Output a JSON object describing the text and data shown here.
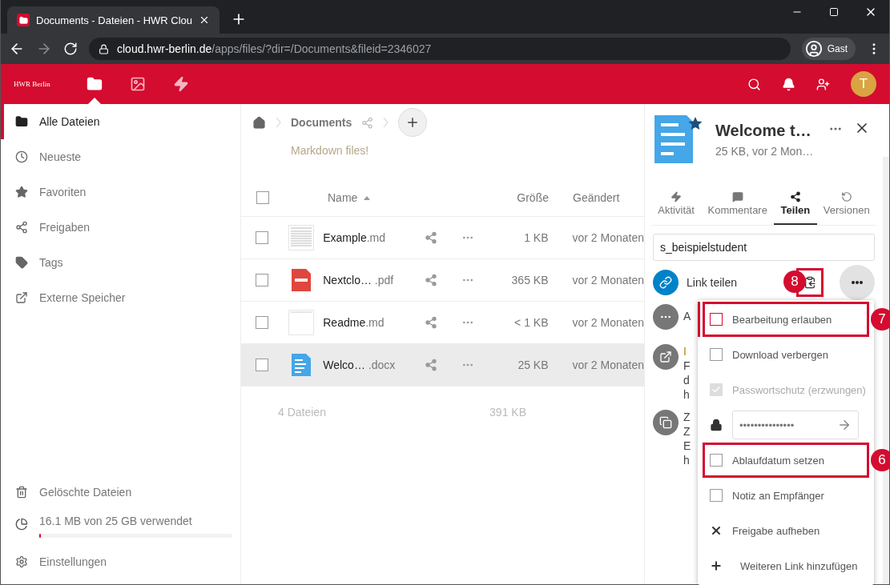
{
  "browser": {
    "tab_title": "Documents - Dateien - HWR Clou",
    "url_host": "cloud.hwr-berlin.de",
    "url_path": "/apps/files/?dir=/Documents&fileid=2346027",
    "profile": "Gast"
  },
  "header": {
    "logo": "HWR Berlin",
    "apps": [
      {
        "kind": "files",
        "selected": true
      },
      {
        "kind": "gallery",
        "selected": false
      },
      {
        "kind": "activity",
        "selected": false
      }
    ],
    "avatar": "T"
  },
  "sidebar": {
    "items": [
      {
        "kind": "folder",
        "label": "Alle Dateien",
        "selected": true
      },
      {
        "kind": "recent",
        "label": "Neueste",
        "selected": false
      },
      {
        "kind": "favorites",
        "label": "Favoriten",
        "selected": false
      },
      {
        "kind": "shares",
        "label": "Freigaben",
        "selected": false
      },
      {
        "kind": "tags",
        "label": "Tags",
        "selected": false
      },
      {
        "kind": "external",
        "label": "Externe Speicher",
        "selected": false
      }
    ],
    "trash": "Gelöschte Dateien",
    "quota": {
      "text": "16.1 MB von 25 GB verwendet",
      "level": 0.01
    },
    "settings": "Einstellungen"
  },
  "files": {
    "all_checked": false,
    "breadcrumb": "Documents",
    "description": "Markdown files!",
    "columns": [
      "Name",
      "Größe",
      "Geändert"
    ],
    "rows": [
      {
        "kind": "md-preview",
        "name": "Example",
        "ext": ".md",
        "size": "1 KB",
        "modified": "vor 2 Monaten",
        "checked": false,
        "selected": false
      },
      {
        "kind": "pdf",
        "name": "Nextclo…",
        "ext": " .pdf",
        "size": "365 KB",
        "modified": "vor 2 Monaten",
        "checked": false,
        "selected": false
      },
      {
        "kind": "md-blank",
        "name": "Readme",
        "ext": ".md",
        "size": "< 1 KB",
        "modified": "vor 2 Monaten",
        "checked": false,
        "selected": false
      },
      {
        "kind": "document",
        "name": "Welco…",
        "ext": " .docx",
        "size": "25 KB",
        "modified": "vor 2 Monaten",
        "checked": false,
        "selected": true
      }
    ],
    "summary": {
      "count": "4 Dateien",
      "size": "391 KB"
    }
  },
  "details": {
    "title": "Welcome t…",
    "subtitle": "25 KB, vor 2 Mon…",
    "tabs": [
      {
        "kind": "activity",
        "label": "Aktivität",
        "selected": false
      },
      {
        "kind": "comments",
        "label": "Kommentare",
        "selected": false
      },
      {
        "kind": "share",
        "label": "Teilen",
        "selected": true
      },
      {
        "kind": "versions",
        "label": "Versionen",
        "selected": false
      }
    ],
    "share_input": "s_beispielstudent",
    "link_label": "Link teilen",
    "copy_marker": "8",
    "hidden_entries": [
      {
        "kind": "more",
        "lines": [
          "A"
        ]
      },
      {
        "kind": "external",
        "lines": [
          "I",
          "F",
          "d",
          "h"
        ]
      },
      {
        "kind": "circle",
        "lines": [
          "Z",
          "Z",
          "E",
          "h"
        ]
      }
    ],
    "menu": [
      {
        "kind": "checkbox",
        "label": "Bearbeitung erlauben",
        "checked": false,
        "disabled": false,
        "marker": "7"
      },
      {
        "kind": "checkbox",
        "label": "Download verbergen",
        "checked": false,
        "disabled": false
      },
      {
        "kind": "checkbox",
        "label": "Passwortschutz (erzwungen)",
        "checked": true,
        "disabled": true
      },
      {
        "kind": "password",
        "value": "•••••••••••••••"
      },
      {
        "kind": "checkbox",
        "label": "Ablaufdatum setzen",
        "checked": false,
        "disabled": false,
        "marker": "6"
      },
      {
        "kind": "checkbox",
        "label": "Notiz an Empfänger",
        "checked": false,
        "disabled": false
      },
      {
        "kind": "remove",
        "label": "Freigabe aufheben"
      },
      {
        "kind": "add",
        "label": "Weiteren Link hinzufügen"
      }
    ]
  }
}
